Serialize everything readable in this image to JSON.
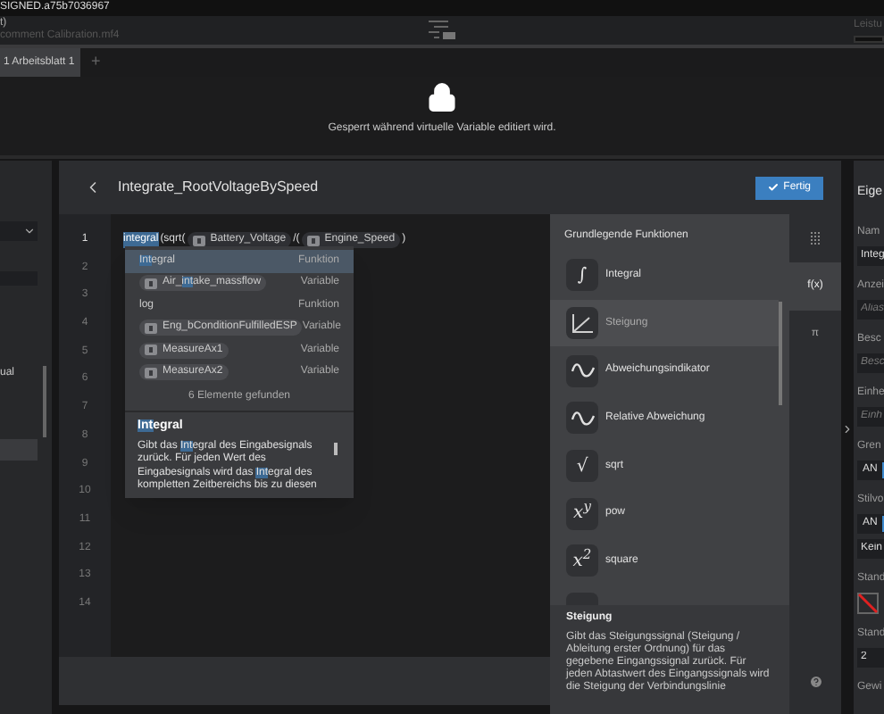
{
  "title_bar": {
    "title": "SIGNED.a75b7036967"
  },
  "header": {
    "line_1": "t)",
    "line_2": "comment Calibration.mf4",
    "right_label": "Leistu"
  },
  "worksheet_tabs": [
    {
      "label": "1  Arbeitsblatt 1",
      "selected": true
    }
  ],
  "add_tab": "+",
  "lock_notice": "Gesperrt während virtuelle Variable editiert wird.",
  "left_panel": {
    "text": "ual"
  },
  "editor": {
    "title": "Integrate_RootVoltageBySpeed",
    "done_button": "Fertig",
    "line_numbers": [
      "1",
      "2",
      "3",
      "4",
      "5",
      "6",
      "7",
      "8",
      "9",
      "10",
      "11",
      "12",
      "13",
      "14"
    ],
    "code": [
      {
        "kind": "text",
        "text": "integral",
        "selected": true
      },
      {
        "kind": "text",
        "text": "(sqrt(",
        "selected": false
      },
      {
        "kind": "chip",
        "text": "Battery_Voltage"
      },
      {
        "kind": "text",
        "text": "/(",
        "selected": false
      },
      {
        "kind": "chip",
        "text": "Engine_Speed"
      },
      {
        "kind": "text",
        "text": ")",
        "selected": false
      }
    ]
  },
  "autocomplete": {
    "items": [
      {
        "kind": "function",
        "match": "Int",
        "after": "egral",
        "type": "Funktion",
        "selected": true
      },
      {
        "kind": "variable",
        "before": "Air_",
        "match": "int",
        "after": "ake_massflow",
        "type": "Variable",
        "selected": false
      },
      {
        "kind": "function",
        "before": "log",
        "type": "Funktion",
        "selected": false
      },
      {
        "kind": "variable",
        "before": "Eng_bConditionFulfilledESP",
        "type": "Variable",
        "selected": false
      },
      {
        "kind": "variable",
        "before": "MeasureAx1",
        "type": "Variable",
        "selected": false
      },
      {
        "kind": "variable",
        "before": "MeasureAx2",
        "type": "Variable",
        "selected": false
      }
    ],
    "footer": "6 Elemente gefunden",
    "detail_title": [
      {
        "text": "Int",
        "match": true
      },
      {
        "text": "egral",
        "match": false
      }
    ],
    "detail_text": [
      {
        "text": "Gibt das ",
        "match": false
      },
      {
        "text": "Int",
        "match": true
      },
      {
        "text": "egral des Eingabesignals zurück. Für jeden Wert des Eingabesignals wird das ",
        "match": false
      },
      {
        "text": "Int",
        "match": true
      },
      {
        "text": "egral des kompletten Zeitbereichs bis zu diesen",
        "match": false
      }
    ]
  },
  "functions": {
    "title": "Grundlegende Funktionen",
    "items": [
      {
        "kind": "symbol",
        "symbol": "∫",
        "label": "Integral",
        "selected": false
      },
      {
        "kind": "slope",
        "label": "Steigung",
        "selected": true
      },
      {
        "kind": "wave",
        "label": "Abweichungsindikator",
        "selected": false
      },
      {
        "kind": "wave",
        "label": "Relative Abweichung",
        "selected": false
      },
      {
        "kind": "symbol",
        "symbol": "√",
        "label": "sqrt",
        "selected": false
      },
      {
        "kind": "symbol",
        "symbol": "x$^{y}$",
        "label": "pow",
        "selected": false
      },
      {
        "kind": "symbol",
        "symbol": "x$^{2}$",
        "label": "square",
        "selected": false
      },
      {
        "kind": "blank",
        "selected": false
      }
    ],
    "detail_title": "Steigung",
    "detail_text": "Gibt das Steigungssignal (Steigung / Ableitung erster Ordnung) für das gegebene Eingangssignal zurück. Für jeden Abtastwert des Eingangssignals wird die Steigung der Verbindungslinie"
  },
  "palette_tabs": [
    {
      "kind": "icon",
      "selected": false
    },
    {
      "kind": "text",
      "label": "f(x)",
      "selected": true
    },
    {
      "kind": "text",
      "label": "π",
      "selected": false
    }
  ],
  "properties": [
    {
      "kind": "heading",
      "text": "Eige"
    },
    {
      "kind": "label",
      "text": "Nam"
    },
    {
      "kind": "field",
      "value": "Integ"
    },
    {
      "kind": "label",
      "text": "Anzei"
    },
    {
      "kind": "field",
      "placeholder": "Alias"
    },
    {
      "kind": "label",
      "text": "Besc"
    },
    {
      "kind": "field",
      "placeholder": "Besc"
    },
    {
      "kind": "label",
      "text": "Einhe"
    },
    {
      "kind": "field",
      "placeholder": "Einh"
    },
    {
      "kind": "label",
      "text": "Gren"
    },
    {
      "kind": "toggle",
      "text": "AN",
      "on": true
    },
    {
      "kind": "label",
      "text": "Stilvo"
    },
    {
      "kind": "toggle",
      "text": "AN",
      "on": true
    },
    {
      "kind": "field",
      "value": "Kein"
    },
    {
      "kind": "label",
      "text": "Stand"
    },
    {
      "kind": "swatch"
    },
    {
      "kind": "label",
      "text": "Stand"
    },
    {
      "kind": "field",
      "value": "2"
    },
    {
      "kind": "label",
      "text": "Gewi"
    }
  ]
}
